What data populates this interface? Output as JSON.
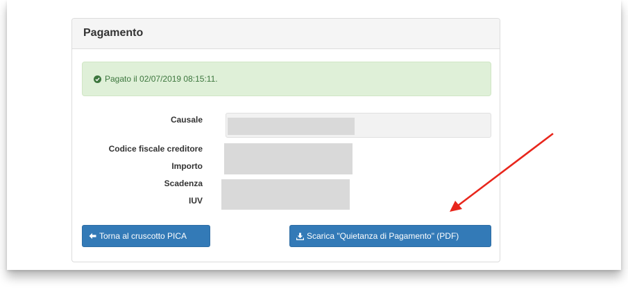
{
  "panel": {
    "title": "Pagamento"
  },
  "alert": {
    "icon": "check-circle-icon",
    "text": "Pagato il 02/07/2019 08:15:11."
  },
  "fields": {
    "causale_label": "Causale",
    "codice_fiscale_label": "Codice fiscale creditore",
    "importo_label": "Importo",
    "scadenza_label": "Scadenza",
    "iuv_label": "IUV"
  },
  "buttons": {
    "back_label": "Torna al cruscotto PICA",
    "back_icon": "arrow-left-icon",
    "download_label": "Scarica \"Quietanza di Pagamento\" (PDF)",
    "download_icon": "download-icon"
  },
  "colors": {
    "primary": "#337ab7",
    "success_bg": "#dff0d8",
    "success_text": "#3c763d",
    "annotation_arrow": "#e8261c"
  }
}
